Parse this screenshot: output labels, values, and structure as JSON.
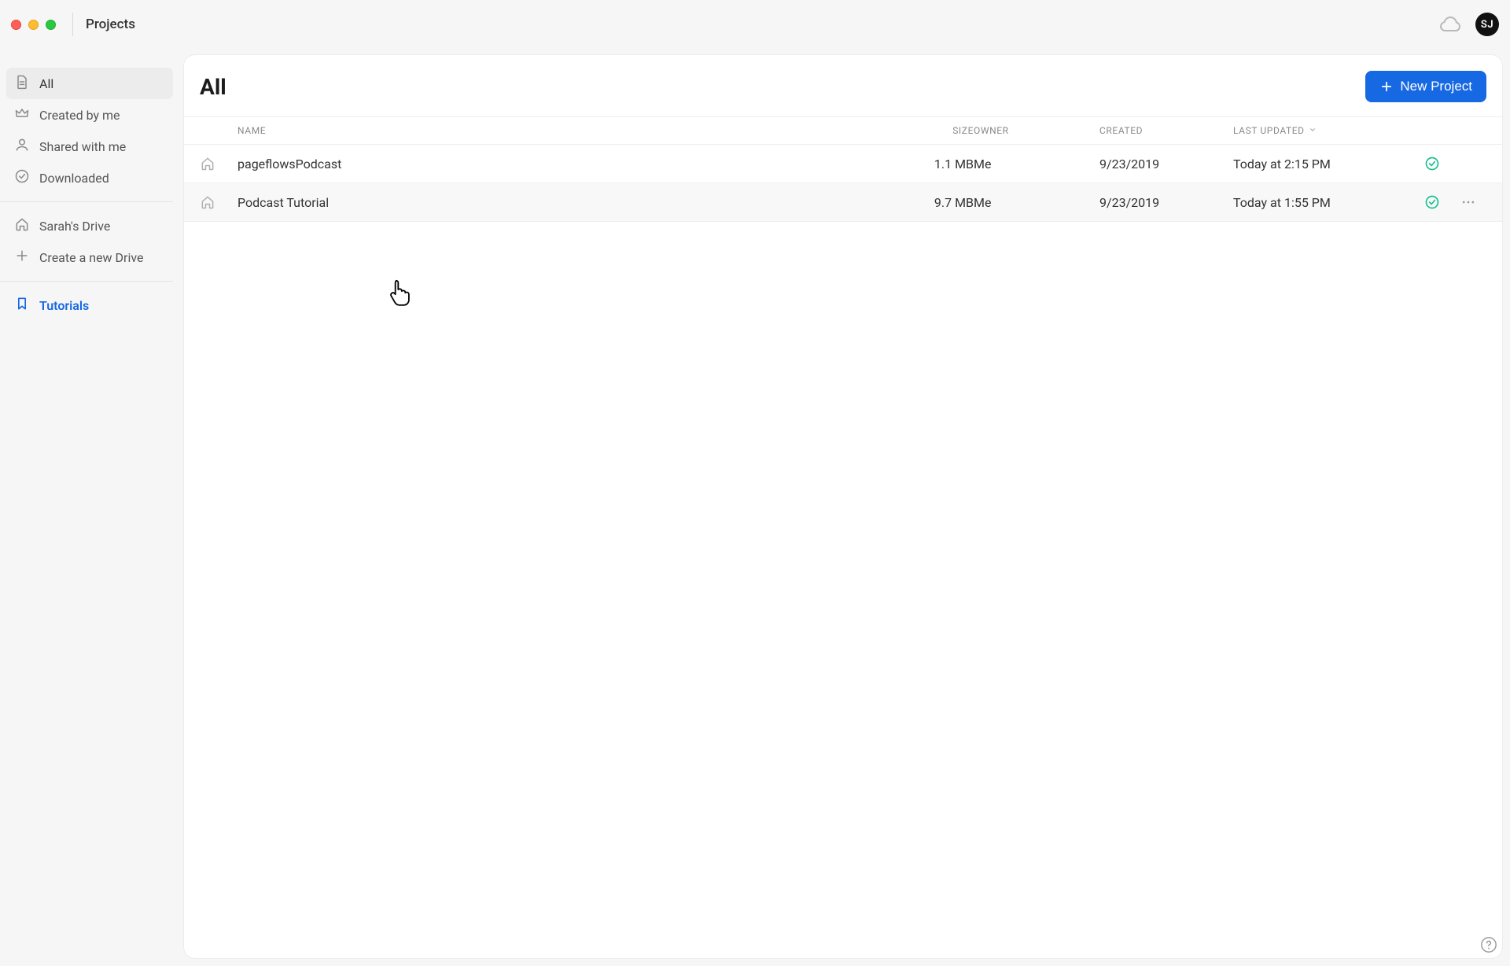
{
  "window": {
    "title": "Projects"
  },
  "user": {
    "initials": "SJ"
  },
  "sidebar": {
    "items": [
      {
        "label": "All"
      },
      {
        "label": "Created by me"
      },
      {
        "label": "Shared with me"
      },
      {
        "label": "Downloaded"
      }
    ],
    "drive_label": "Sarah's Drive",
    "create_drive_label": "Create a new Drive",
    "tutorials_label": "Tutorials"
  },
  "main": {
    "title": "All",
    "new_project_label": "New Project",
    "columns": {
      "name": "Name",
      "size": "Size",
      "owner": "Owner",
      "created": "Created",
      "updated": "Last Updated"
    },
    "rows": [
      {
        "name": "pageflowsPodcast",
        "size": "1.1 MB",
        "owner": "Me",
        "created": "9/23/2019",
        "updated": "Today at 2:15 PM"
      },
      {
        "name": "Podcast Tutorial",
        "size": "9.7 MB",
        "owner": "Me",
        "created": "9/23/2019",
        "updated": "Today at 1:55 PM"
      }
    ]
  }
}
